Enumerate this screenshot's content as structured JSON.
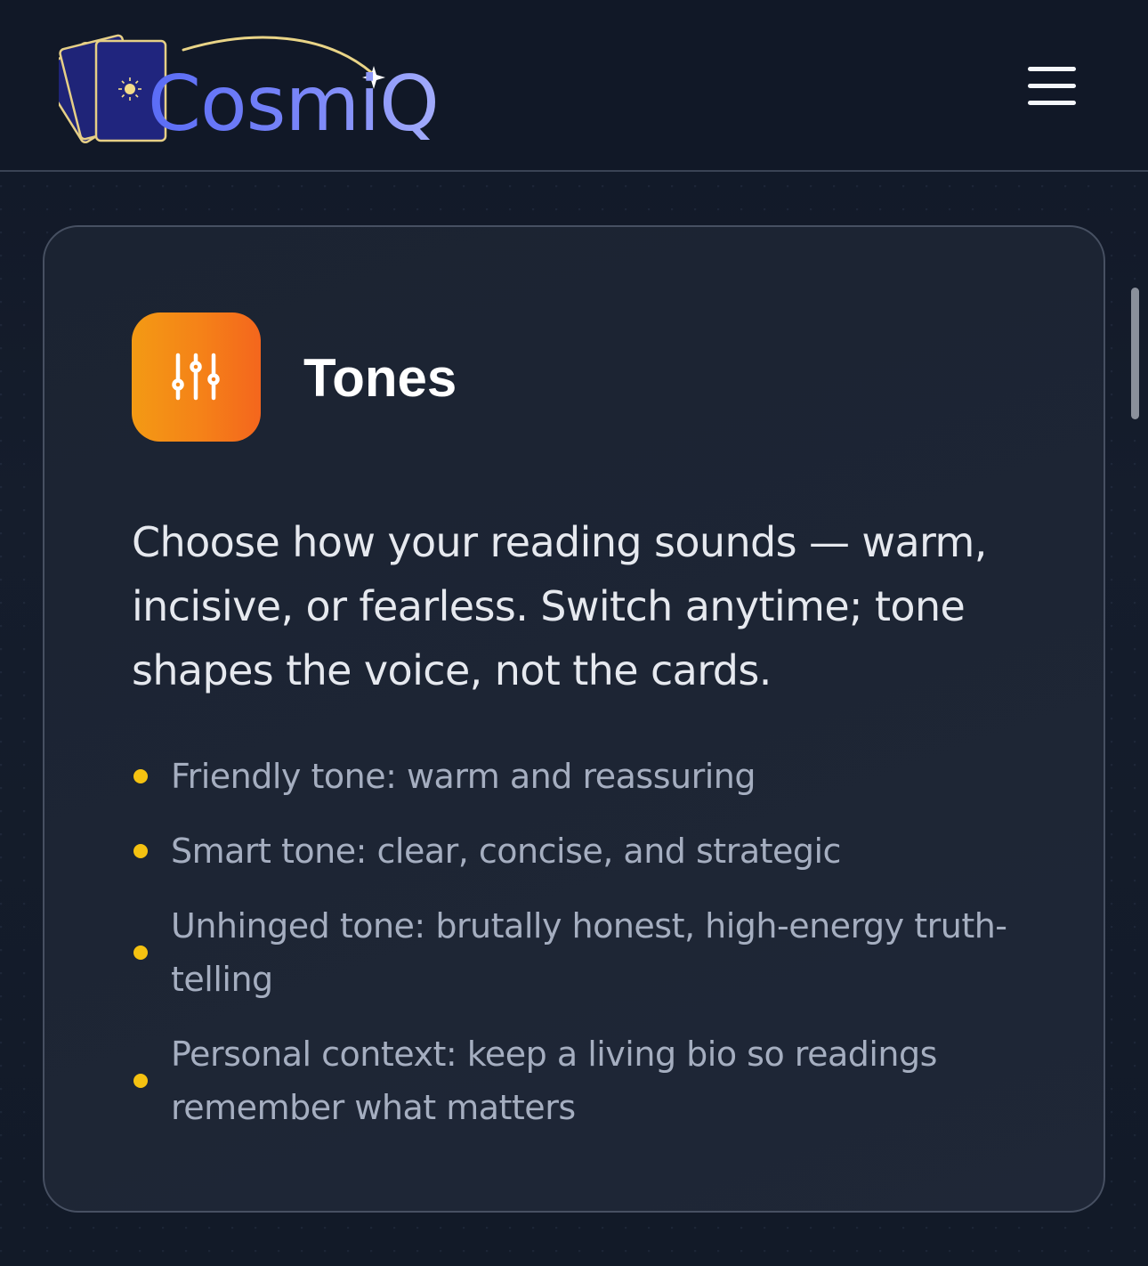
{
  "header": {
    "logo_text": "CosmiQ",
    "menu_icon": "hamburger-menu-icon"
  },
  "card": {
    "icon": "sliders-icon",
    "title": "Tones",
    "description": "Choose how your reading sounds — warm, incisive, or fearless. Switch anytime; tone shapes the voice, not the cards.",
    "features": [
      "Friendly tone: warm and reassuring",
      "Smart tone: clear, concise, and strategic",
      "Unhinged tone: brutally honest, high-energy truth-telling",
      "Personal context: keep a living bio so readings remember what matters"
    ]
  },
  "colors": {
    "background": "#141c2b",
    "accent_orange": "#f58118",
    "bullet_yellow": "#f5c211",
    "logo_indigo": "#6b79f7"
  }
}
